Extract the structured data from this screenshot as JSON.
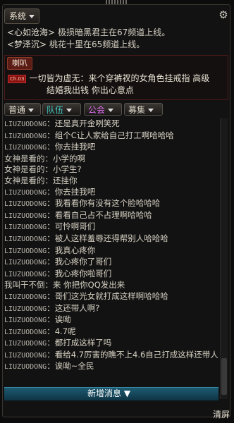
{
  "system": {
    "tab_label": "系统"
  },
  "system_messages": [
    {
      "user": "<心如沧海>",
      "text": "极损暗黑君主在67频道上线。"
    },
    {
      "user": "<梦泽沉>",
      "text": "桃花十里在65频道上线。"
    }
  ],
  "horn": {
    "tab_label": "喇叭",
    "badge": "Ch.03",
    "line1": "一切皆为虚无：来个穿裤衩的女角色挂戒指   高级",
    "line2": "结婚我出钱  你出心意点"
  },
  "channels": {
    "putong": "普通",
    "duiwu": "队伍",
    "gonghui": "公会",
    "mouji": "募集"
  },
  "colors": {
    "putong": "#e8e0d0",
    "duiwu": "#3fc7c0",
    "gonghui": "#e06cf0",
    "mouji": "#d8d2c4"
  },
  "chat": [
    {
      "name": "LIUZUODONG",
      "text": "还是真开金咧笑死"
    },
    {
      "name": "LIUZUODONG",
      "text": "组个C让人家给自己打工啊哈哈哈"
    },
    {
      "name": "LIUZUODONG",
      "text": "你去挂我吧"
    },
    {
      "name": "女神是看的",
      "text": "小学的啊"
    },
    {
      "name": "女神是看的",
      "text": "小学生?"
    },
    {
      "name": "女神是看的",
      "text": "还挂你"
    },
    {
      "name": "LIUZUODONG",
      "text": "你去挂我吧"
    },
    {
      "name": "LIUZUODONG",
      "text": "我看看你有没有这个脸哈哈哈"
    },
    {
      "name": "LIUZUODONG",
      "text": "看看自己占不占理啊哈哈哈"
    },
    {
      "name": "LIUZUODONG",
      "text": "可怜啊哥们"
    },
    {
      "name": "LIUZUODONG",
      "text": "被人这样羞辱还得帮别人哈哈哈"
    },
    {
      "name": "LIUZUODONG",
      "text": "我真心疼你"
    },
    {
      "name": "LIUZUODONG",
      "text": "我心疼你了哥们"
    },
    {
      "name": "LIUZUODONG",
      "text": "我心疼你啦哥们"
    },
    {
      "name": "我叫干不倒",
      "text": "来 你把你QQ发出来"
    },
    {
      "name": "LIUZUODONG",
      "text": "哥们这光女就打成这样啊哈哈哈"
    },
    {
      "name": "LIUZUODONG",
      "text": "这还带人啊?"
    },
    {
      "name": "LIUZUODONG",
      "text": "诶呦"
    },
    {
      "name": "LIUZUODONG",
      "text": "4.7呢"
    },
    {
      "name": "LIUZUODONG",
      "text": "都打成这样了吗"
    },
    {
      "name": "LIUZUODONG",
      "text": "看给4.7厉害的瞧不上4.6自己打成这样还带人"
    },
    {
      "name": "LIUZUODONG",
      "text": "诶呦~全民"
    }
  ],
  "new_messages_label": "新增消息",
  "clear_label": "清屏"
}
